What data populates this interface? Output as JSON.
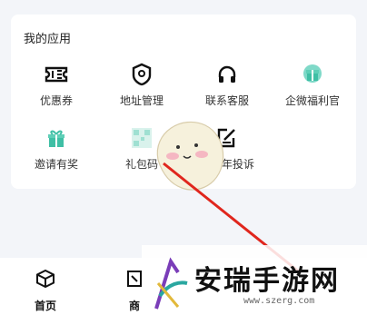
{
  "section": {
    "title": "我的应用"
  },
  "apps": [
    {
      "label": "优惠券",
      "icon": "ticket-icon"
    },
    {
      "label": "地址管理",
      "icon": "location-pin-icon"
    },
    {
      "label": "联系客服",
      "icon": "headphones-icon"
    },
    {
      "label": "企微福利官",
      "icon": "gift-icon"
    },
    {
      "label": "邀请有奖",
      "icon": "gift-box-icon"
    },
    {
      "label": "礼包码",
      "icon": "qr-code-icon"
    },
    {
      "label": "未成年投诉",
      "icon": "edit-document-icon"
    }
  ],
  "bottom_nav": [
    {
      "label": "首页",
      "icon": "cube-icon"
    },
    {
      "label": "商",
      "icon": "store-icon"
    }
  ],
  "watermark": {
    "text": "安瑞手游网",
    "url": "www.szerg.com"
  }
}
